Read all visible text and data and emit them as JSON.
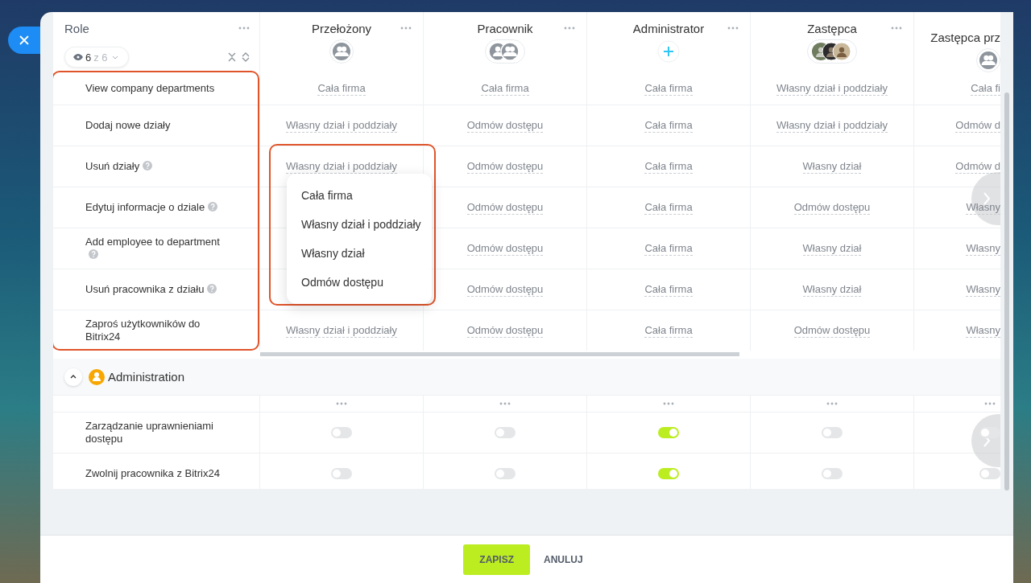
{
  "header": {
    "title": "Role",
    "filter": {
      "shown": "6",
      "total": "z 6"
    }
  },
  "columns": [
    {
      "name": "Przełożony",
      "menu": true,
      "kind": "group"
    },
    {
      "name": "Pracownik",
      "menu": true,
      "kind": "user-group"
    },
    {
      "name": "Administrator",
      "menu": true,
      "kind": "add"
    },
    {
      "name": "Zastępca",
      "menu": true,
      "kind": "people"
    },
    {
      "name": "Zastępca prz",
      "menu": false,
      "kind": "group"
    }
  ],
  "permissions": [
    {
      "label": "View company departments",
      "help": false,
      "values": [
        "Cała firma",
        "Cała firma",
        "Cała firma",
        "Własny dział i poddziały",
        "Cała fi"
      ]
    },
    {
      "label": "Dodaj nowe działy",
      "help": false,
      "values": [
        "Własny dział i poddziały",
        "Odmów dostępu",
        "Cała firma",
        "Własny dział i poddziały",
        "Odmów d"
      ]
    },
    {
      "label": "Usuń działy",
      "help": true,
      "values": [
        "Własny dział i poddziały",
        "Odmów dostępu",
        "Cała firma",
        "Własny dział",
        "Odmów d"
      ]
    },
    {
      "label": "Edytuj informacje o dziale",
      "help": true,
      "covered_first": true,
      "values": [
        "Odmów dostępu",
        "Cała firma",
        "Odmów dostępu",
        "Własny"
      ]
    },
    {
      "label": "Add employee to department",
      "help": true,
      "covered_first": true,
      "values": [
        "Odmów dostępu",
        "Cała firma",
        "Własny dział",
        "Własny"
      ]
    },
    {
      "label": "Usuń pracownika z działu",
      "help": true,
      "covered_first": true,
      "values": [
        "Odmów dostępu",
        "Cała firma",
        "Własny dział",
        "Własny"
      ]
    },
    {
      "label": "Zaproś użytkowników do Bitrix24",
      "help": false,
      "values": [
        "Własny dział i poddziały",
        "Odmów dostępu",
        "Cała firma",
        "Odmów dostępu",
        "Własny"
      ]
    }
  ],
  "dropdown": {
    "options": [
      "Cała firma",
      "Własny dział i poddziały",
      "Własny dział",
      "Odmów dostępu"
    ]
  },
  "group": {
    "title": "Administration",
    "expanded": true,
    "rows": [
      {
        "label": "Zarządzanie uprawnieniami dostępu",
        "toggles": [
          {
            "on": false
          },
          {
            "on": false
          },
          {
            "on": true
          },
          {
            "on": false
          },
          {
            "on": false
          }
        ]
      },
      {
        "label": "Zwolnij pracownika z Bitrix24",
        "toggles": [
          {
            "on": false
          },
          {
            "on": false
          },
          {
            "on": true
          },
          {
            "on": false
          },
          {
            "on": false
          }
        ]
      }
    ]
  },
  "footer": {
    "buttons": [
      {
        "label": "ZAPISZ",
        "kind": "primary"
      },
      {
        "label": "ANULUJ",
        "kind": "link"
      }
    ]
  }
}
